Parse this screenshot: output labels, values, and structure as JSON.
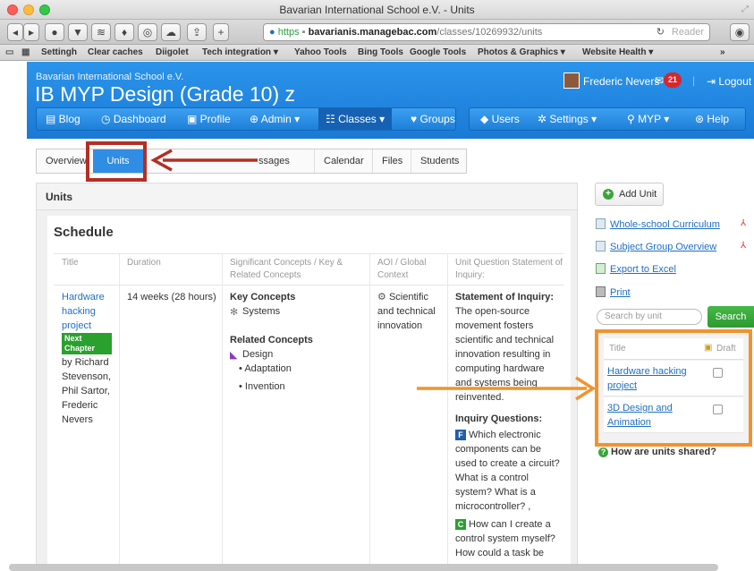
{
  "window": {
    "title": "Bavarian International School e.V. - Units"
  },
  "browser": {
    "url_https": "https",
    "url_domain": "bavarianis.managebac.com",
    "url_path": "/classes/10269932/units",
    "reader_label": "Reader",
    "bookmarks": [
      "Settingh",
      "Clear caches",
      "Diigolet",
      "Tech integration ▾",
      "Yahoo Tools",
      "Bing Tools",
      "Google Tools",
      "Photos & Graphics ▾",
      "Website Health ▾"
    ],
    "overflow": "»"
  },
  "header": {
    "school": "Bavarian International School e.V.",
    "class_title": "IB MYP Design (Grade 10) z",
    "user_name": "Frederic Nevers",
    "message_count": "21",
    "logout_label": "Logout",
    "nav": {
      "blog": "Blog",
      "dashboard": "Dashboard",
      "profile": "Profile",
      "admin": "Admin",
      "classes": "Classes",
      "groups": "Groups",
      "users": "Users",
      "settings": "Settings",
      "myp": "MYP",
      "help": "Help"
    }
  },
  "tabs": {
    "overview": "Overview",
    "units": "Units",
    "messages": "ssages",
    "calendar": "Calendar",
    "files": "Files",
    "students": "Students"
  },
  "panel": {
    "title": "Units",
    "schedule_title": "Schedule",
    "columns": {
      "title": "Title",
      "duration": "Duration",
      "concepts": "Significant Concepts / Key & Related Concepts",
      "aoi": "AOI / Global Context",
      "inquiry": "Unit Question Statement of Inquiry:"
    },
    "row": {
      "title_link": "Hardware hacking project",
      "badge": "Next Chapter",
      "authors": "by Richard Stevenson, Phil Sartor, Frederic Nevers",
      "duration": "14 weeks (28 hours)",
      "key_concepts_label": "Key Concepts",
      "key_concept": "Systems",
      "related_concepts_label": "Related Concepts",
      "related_main": "Design",
      "related_sub1": "Adaptation",
      "related_sub2": "Invention",
      "aoi": "Scientific and technical innovation",
      "statement_label": "Statement of Inquiry:",
      "statement_text": "The open-source movement fosters scientific and technical innovation resulting in computing hardware and systems being reinvented.",
      "inquiry_label": "Inquiry Questions:",
      "q_f_badge": "F",
      "q_f": "Which electronic components can be used to create a circuit? What is a control system? What is a microcontroller? ,",
      "q_c_badge": "C",
      "q_c": "How can I create a control system myself? How could a task be"
    }
  },
  "sidebar": {
    "add_unit": "Add Unit",
    "whole_school": "Whole-school Curriculum",
    "subject_group": "Subject Group Overview",
    "export": "Export to Excel",
    "print": "Print",
    "search_placeholder": "Search by unit",
    "search_button": "Search",
    "list_title_header": "Title",
    "list_draft_header": "Draft",
    "units": [
      "Hardware hacking project",
      "3D Design and Animation"
    ],
    "help_text": "How are units shared?"
  },
  "colors": {
    "brand_blue": "#1a85e0",
    "highlight_red": "#b32e24",
    "highlight_orange": "#f0932f",
    "badge_green": "#2aa02e"
  }
}
